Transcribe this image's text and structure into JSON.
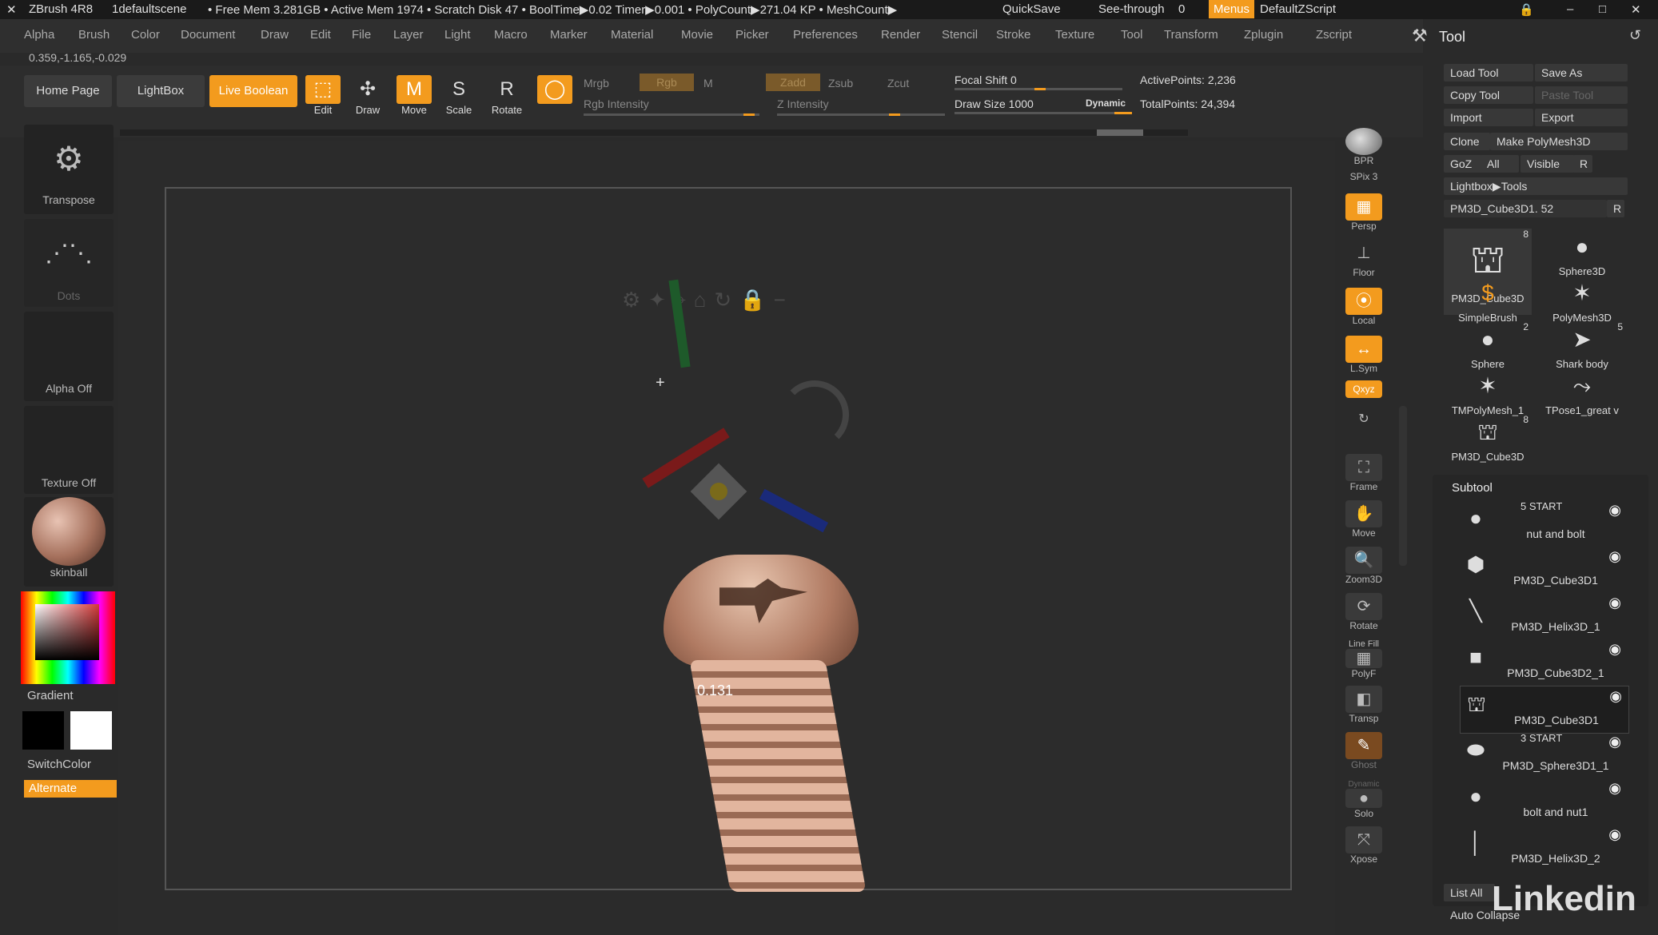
{
  "titlebar": {
    "app": "ZBrush 4R8",
    "scene": "1defaultscene",
    "stats": "• Free Mem 3.281GB • Active Mem 1974 • Scratch Disk 47 • BoolTime▶0.02 Timer▶0.001 • PolyCount▶271.04 KP • MeshCount▶",
    "quicksave": "QuickSave",
    "seethrough": "See-through",
    "seethrough_value": "0",
    "menus": "Menus",
    "script": "DefaultZScript"
  },
  "menu": [
    "Alpha",
    "Brush",
    "Color",
    "Document",
    "Draw",
    "Edit",
    "File",
    "Layer",
    "Light",
    "Macro",
    "Marker",
    "Material",
    "Movie",
    "Picker",
    "Preferences",
    "Render",
    "Stencil",
    "Stroke",
    "Texture",
    "Tool",
    "Transform",
    "Zplugin",
    "Zscript"
  ],
  "coords": "0.359,-1.165,-0.029",
  "shelf": {
    "home": "Home Page",
    "lightbox": "LightBox",
    "liveboolean": "Live Boolean",
    "edit": "Edit",
    "draw": "Draw",
    "move": "Move",
    "scale": "Scale",
    "rotate": "Rotate",
    "mrgb": "Mrgb",
    "rgb": "Rgb",
    "m": "M",
    "zadd": "Zadd",
    "zsub": "Zsub",
    "zcut": "Zcut",
    "rgb_intensity": "Rgb Intensity",
    "z_intensity": "Z Intensity",
    "focal_shift": "Focal Shift 0",
    "draw_size": "Draw Size 1000",
    "dynamic": "Dynamic",
    "active_points": "ActivePoints: 2,236",
    "total_points": "TotalPoints: 24,394"
  },
  "left": {
    "transpose": "Transpose",
    "dots": "Dots",
    "alpha": "Alpha Off",
    "texture": "Texture Off",
    "material": "skinball",
    "gradient": "Gradient",
    "switchcolor": "SwitchColor",
    "alternate": "Alternate"
  },
  "viewport": {
    "gizmo_value": "0.131"
  },
  "rshelf": {
    "bpr": "BPR",
    "spix": "SPix 3",
    "persp": "Persp",
    "floor": "Floor",
    "local": "Local",
    "lsym": "L.Sym",
    "xyz": "Qxyz",
    "frame": "Frame",
    "move": "Move",
    "zoom3d": "Zoom3D",
    "rotate": "Rotate",
    "polyf": "PolyF",
    "linefill": "Line Fill",
    "transp": "Transp",
    "ghost": "Ghost",
    "dynamic": "Dynamic",
    "solo": "Solo",
    "xpose": "Xpose"
  },
  "tool": {
    "title": "Tool",
    "load": "Load Tool",
    "saveas": "Save As",
    "copy": "Copy Tool",
    "paste": "Paste Tool",
    "import": "Import",
    "export": "Export",
    "clone": "Clone",
    "makepoly": "Make PolyMesh3D",
    "goz": "GoZ",
    "all": "All",
    "visible": "Visible",
    "r": "R",
    "lightboxtools": "Lightbox▶Tools",
    "current": "PM3D_Cube3D1. 52",
    "thumbs": [
      {
        "label": "PM3D_Cube3D",
        "badge": "8"
      },
      {
        "label": "Sphere3D",
        "badge": ""
      },
      {
        "label": "SimpleBrush",
        "badge": ""
      },
      {
        "label": "PolyMesh3D",
        "badge": ""
      },
      {
        "label": "Sphere",
        "badge": "2"
      },
      {
        "label": "Shark body",
        "badge": "5"
      },
      {
        "label": "TMPolyMesh_1",
        "badge": ""
      },
      {
        "label": "TPose1_great v",
        "badge": ""
      },
      {
        "label": "PM3D_Cube3D",
        "badge": "8"
      }
    ],
    "subtool_title": "Subtool",
    "subtools": [
      {
        "status": "5 START",
        "label": "nut and bolt"
      },
      {
        "status": "",
        "label": "PM3D_Cube3D1"
      },
      {
        "status": "",
        "label": "PM3D_Helix3D_1"
      },
      {
        "status": "",
        "label": "PM3D_Cube3D2_1"
      },
      {
        "status": "",
        "label": "PM3D_Cube3D1"
      },
      {
        "status": "3 START",
        "label": "PM3D_Sphere3D1_1"
      },
      {
        "status": "",
        "label": "bolt and nut1"
      },
      {
        "status": "",
        "label": "PM3D_Helix3D_2"
      }
    ],
    "listall": "List All",
    "autocollapse": "Auto Collapse"
  },
  "watermark": "Linkedin"
}
